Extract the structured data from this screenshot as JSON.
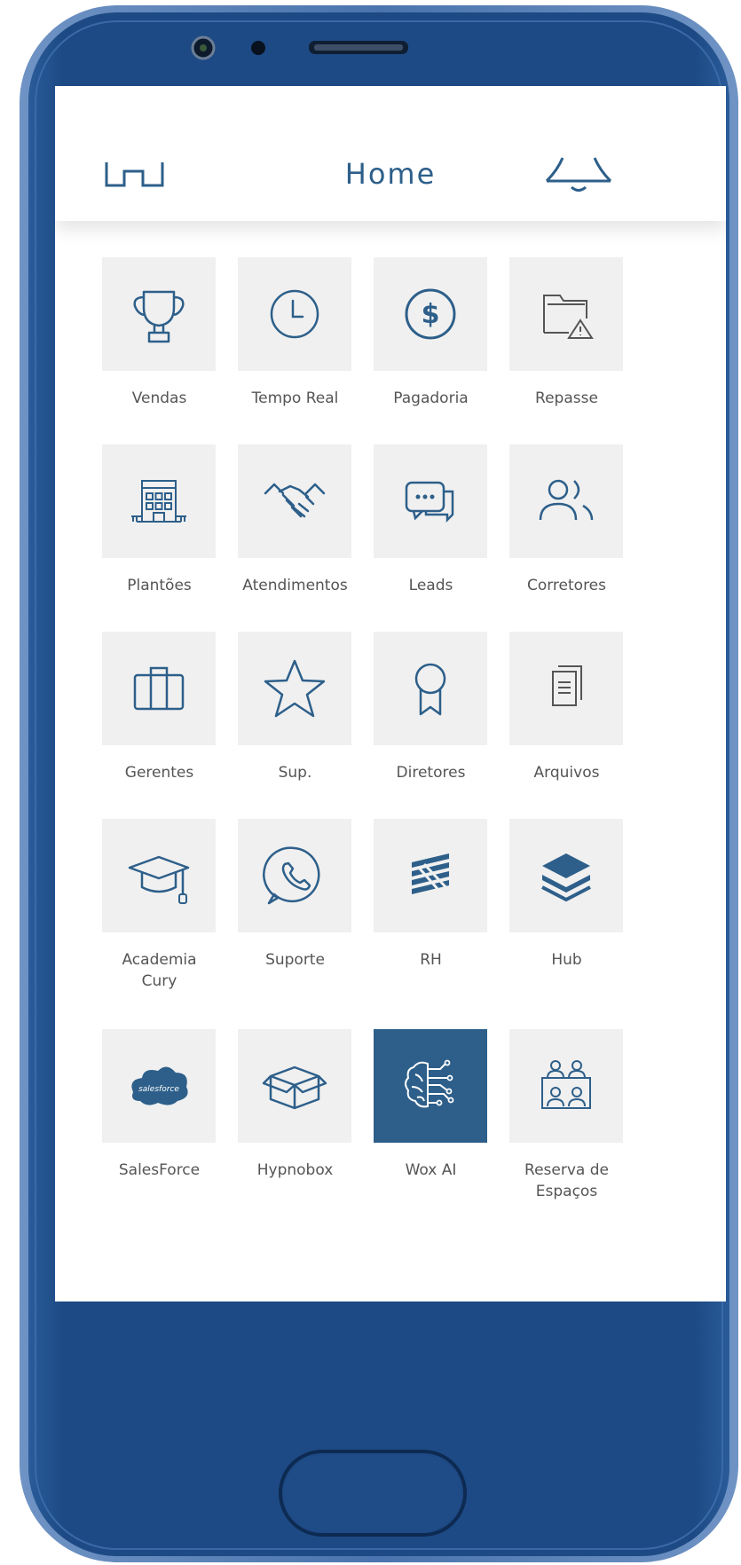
{
  "header": {
    "title": "Home",
    "menu_icon": "menu-icon",
    "notification_icon": "bell-icon"
  },
  "colors": {
    "accent": "#2d5f8a",
    "tile_bg": "#f0f0f0",
    "label": "#555555",
    "frame": "#1e4a82"
  },
  "tiles": [
    {
      "label": "Vendas",
      "icon": "trophy-icon"
    },
    {
      "label": "Tempo Real",
      "icon": "clock-icon"
    },
    {
      "label": "Pagadoria",
      "icon": "dollar-icon"
    },
    {
      "label": "Repasse",
      "icon": "folder-warning-icon"
    },
    {
      "label": "Plantões",
      "icon": "building-icon"
    },
    {
      "label": "Atendimentos",
      "icon": "handshake-icon"
    },
    {
      "label": "Leads",
      "icon": "chat-icon"
    },
    {
      "label": "Corretores",
      "icon": "users-icon"
    },
    {
      "label": "Gerentes",
      "icon": "briefcase-icon"
    },
    {
      "label": "Sup.",
      "icon": "star-icon"
    },
    {
      "label": "Diretores",
      "icon": "award-icon"
    },
    {
      "label": "Arquivos",
      "icon": "documents-icon"
    },
    {
      "label": "Academia\nCury",
      "icon": "graduation-cap-icon"
    },
    {
      "label": "Suporte",
      "icon": "whatsapp-icon"
    },
    {
      "label": "RH",
      "icon": "rh-logo-icon"
    },
    {
      "label": "Hub",
      "icon": "layers-icon"
    },
    {
      "label": "SalesForce",
      "icon": "salesforce-cloud-icon",
      "logo_text": "salesforce"
    },
    {
      "label": "Hypnobox",
      "icon": "box-icon"
    },
    {
      "label": "Wox AI",
      "icon": "ai-brain-icon",
      "active": true
    },
    {
      "label": "Reserva de\nEspaços",
      "icon": "meeting-room-icon"
    }
  ]
}
